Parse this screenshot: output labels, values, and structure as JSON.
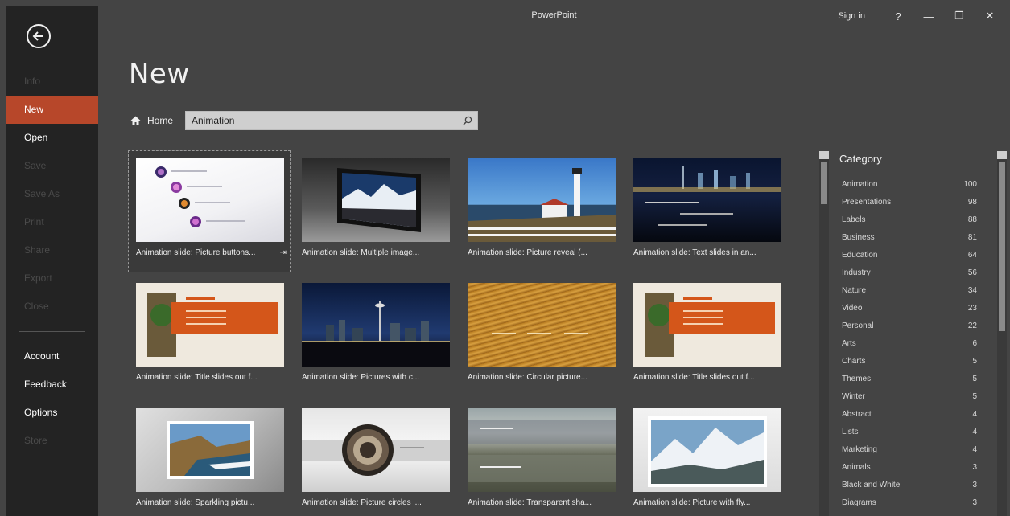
{
  "window": {
    "title": "PowerPoint",
    "sign_in": "Sign in",
    "help": "?",
    "minimize": "—",
    "restore": "❐",
    "close": "✕"
  },
  "sidebar": {
    "items": [
      {
        "label": "Info",
        "state": "disabled"
      },
      {
        "label": "New",
        "state": "active"
      },
      {
        "label": "Open",
        "state": "normal"
      },
      {
        "label": "Save",
        "state": "disabled"
      },
      {
        "label": "Save As",
        "state": "disabled"
      },
      {
        "label": "Print",
        "state": "disabled"
      },
      {
        "label": "Share",
        "state": "disabled"
      },
      {
        "label": "Export",
        "state": "disabled"
      },
      {
        "label": "Close",
        "state": "disabled"
      }
    ],
    "bottom_items": [
      {
        "label": "Account",
        "state": "normal"
      },
      {
        "label": "Feedback",
        "state": "normal"
      },
      {
        "label": "Options",
        "state": "normal"
      },
      {
        "label": "Store",
        "state": "disabled"
      }
    ],
    "active_color": "#b7472a"
  },
  "main": {
    "title": "New",
    "home_label": "Home",
    "search_value": "Animation",
    "templates": [
      {
        "label": "Animation slide: Picture buttons...",
        "selected": true
      },
      {
        "label": "Animation slide: Multiple image..."
      },
      {
        "label": "Animation slide: Picture reveal (..."
      },
      {
        "label": "Animation slide: Text slides in an..."
      },
      {
        "label": "Animation slide: Title slides out f..."
      },
      {
        "label": "Animation slide: Pictures with c..."
      },
      {
        "label": "Animation slide: Circular picture..."
      },
      {
        "label": "Animation slide: Title slides out f..."
      },
      {
        "label": "Animation slide: Sparkling pictu..."
      },
      {
        "label": "Animation slide: Picture circles i..."
      },
      {
        "label": "Animation slide: Transparent sha..."
      },
      {
        "label": "Animation slide: Picture with fly..."
      }
    ]
  },
  "category": {
    "title": "Category",
    "items": [
      {
        "name": "Animation",
        "count": "100"
      },
      {
        "name": "Presentations",
        "count": "98"
      },
      {
        "name": "Labels",
        "count": "88"
      },
      {
        "name": "Business",
        "count": "81"
      },
      {
        "name": "Education",
        "count": "64"
      },
      {
        "name": "Industry",
        "count": "56"
      },
      {
        "name": "Nature",
        "count": "34"
      },
      {
        "name": "Video",
        "count": "23"
      },
      {
        "name": "Personal",
        "count": "22"
      },
      {
        "name": "Arts",
        "count": "6"
      },
      {
        "name": "Charts",
        "count": "5"
      },
      {
        "name": "Themes",
        "count": "5"
      },
      {
        "name": "Winter",
        "count": "5"
      },
      {
        "name": "Abstract",
        "count": "4"
      },
      {
        "name": "Lists",
        "count": "4"
      },
      {
        "name": "Marketing",
        "count": "4"
      },
      {
        "name": "Animals",
        "count": "3"
      },
      {
        "name": "Black and White",
        "count": "3"
      },
      {
        "name": "Diagrams",
        "count": "3"
      }
    ]
  }
}
